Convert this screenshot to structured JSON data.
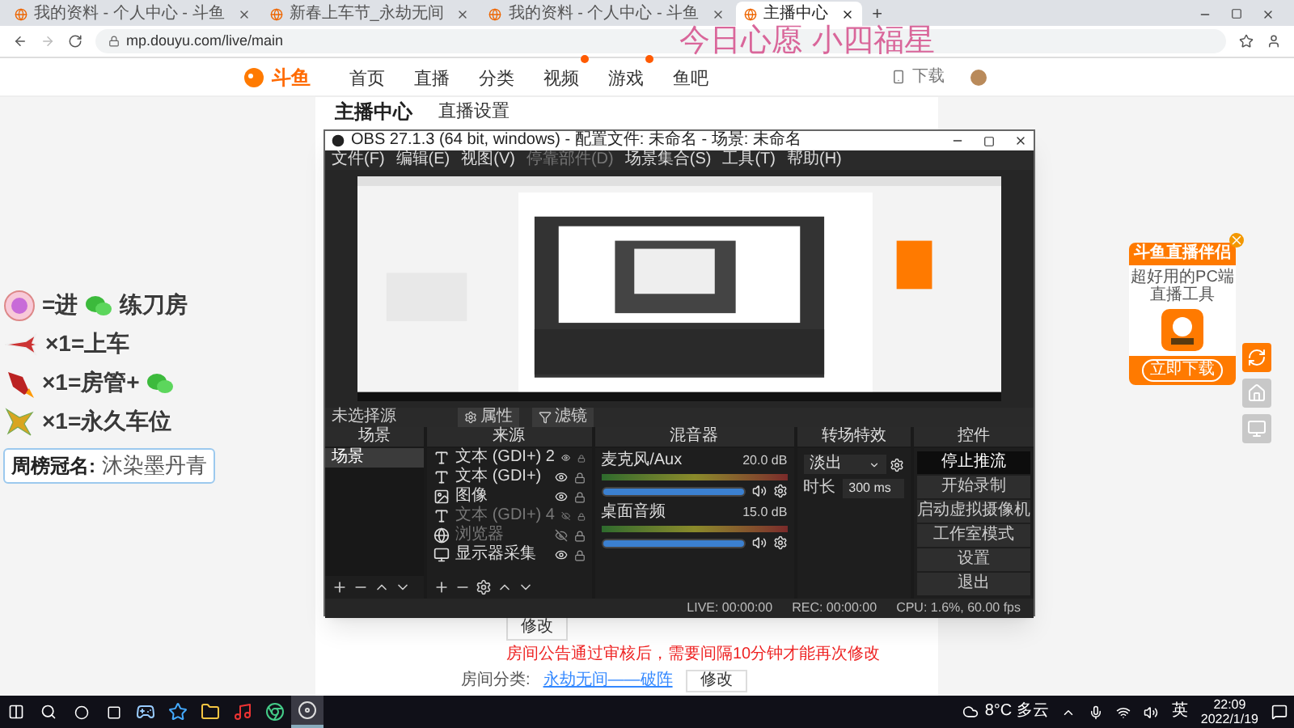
{
  "stream_overlay": {
    "wish_text": "今日心愿 小四福星"
  },
  "browser": {
    "tabs": [
      {
        "title": "我的资料 - 个人中心 - 斗鱼",
        "selected": false
      },
      {
        "title": "新春上车节_永劫无间",
        "selected": false
      },
      {
        "title": "我的资料 - 个人中心 - 斗鱼",
        "selected": false
      },
      {
        "title": "主播中心",
        "selected": true
      }
    ],
    "new_tab": "+",
    "url": "mp.douyu.com/live/main"
  },
  "site_header": {
    "logo": "斗鱼",
    "nav": [
      {
        "label": "首页",
        "badge": false
      },
      {
        "label": "直播",
        "badge": false
      },
      {
        "label": "分类",
        "badge": false
      },
      {
        "label": "视频",
        "badge": true
      },
      {
        "label": "游戏",
        "badge": true
      },
      {
        "label": "鱼吧",
        "badge": false
      }
    ],
    "download": "下载"
  },
  "page": {
    "sidebar_title": "主播中心",
    "section_title": "直播设置",
    "edit_button": "修改",
    "notice": "房间公告通过审核后，需要间隔10分钟才能再次修改",
    "category_label": "房间分类:",
    "category_value": "永劫无间——破阵",
    "category_button": "修改"
  },
  "gift_overlay": {
    "rows": [
      {
        "kind": "medal",
        "before": "=进",
        "wechat": true,
        "after": "练刀房"
      },
      {
        "kind": "plane",
        "before": "×1=上车",
        "wechat": false,
        "after": ""
      },
      {
        "kind": "rocket",
        "before": "×1=房管+",
        "wechat": true,
        "after": ""
      },
      {
        "kind": "spaceship",
        "before": "×1=永久车位",
        "wechat": false,
        "after": ""
      }
    ],
    "crown_label": "周榜冠名:",
    "crown_name": "沐染墨丹青"
  },
  "obs": {
    "title": "OBS 27.1.3 (64 bit, windows) - 配置文件: 未命名 - 场景: 未命名",
    "menu": [
      {
        "label": "文件(F)",
        "disabled": false
      },
      {
        "label": "编辑(E)",
        "disabled": false
      },
      {
        "label": "视图(V)",
        "disabled": false
      },
      {
        "label": "停靠部件(D)",
        "disabled": true
      },
      {
        "label": "场景集合(S)",
        "disabled": false
      },
      {
        "label": "工具(T)",
        "disabled": false
      },
      {
        "label": "帮助(H)",
        "disabled": false
      }
    ],
    "selection": "未选择源",
    "properties_button": "属性",
    "filters_button": "滤镜",
    "scenes": {
      "title": "场景",
      "items": [
        {
          "name": "场景",
          "selected": true
        }
      ]
    },
    "sources": {
      "title": "来源",
      "items": [
        {
          "kind": "text",
          "name": "文本 (GDI+) 2",
          "visible": true
        },
        {
          "kind": "text",
          "name": "文本 (GDI+)",
          "visible": true
        },
        {
          "kind": "image",
          "name": "图像",
          "visible": true
        },
        {
          "kind": "text",
          "name": "文本 (GDI+) 4",
          "visible": false
        },
        {
          "kind": "browser",
          "name": "浏览器",
          "visible": false
        },
        {
          "kind": "display",
          "name": "显示器采集",
          "visible": true
        }
      ]
    },
    "mixer": {
      "title": "混音器",
      "channels": [
        {
          "name": "麦克风/Aux",
          "reading": "20.0 dB",
          "level": 1
        },
        {
          "name": "桌面音频",
          "reading": "15.0 dB",
          "level": 1
        }
      ]
    },
    "transitions": {
      "title": "转场特效",
      "type": "淡出",
      "duration_label": "时长",
      "duration": "300 ms"
    },
    "controls": {
      "title": "控件",
      "buttons": [
        {
          "label": "停止推流",
          "active": true
        },
        {
          "label": "开始录制",
          "active": false
        },
        {
          "label": "启动虚拟摄像机",
          "active": false
        },
        {
          "label": "工作室模式",
          "active": false
        },
        {
          "label": "设置",
          "active": false
        },
        {
          "label": "退出",
          "active": false
        }
      ]
    },
    "status": {
      "live": "LIVE: 00:00:00",
      "rec": "REC: 00:00:00",
      "cpu": "CPU: 1.6%, 60.00 fps"
    }
  },
  "ad": {
    "title": "斗鱼直播伴侣",
    "subtitle": "超好用的PC端直播工具",
    "button": "立即下载"
  },
  "side_buttons": [
    {
      "kind": "replay",
      "selected": true
    },
    {
      "kind": "home",
      "selected": false
    },
    {
      "kind": "screen",
      "selected": false
    }
  ],
  "taskbar": {
    "apps": [
      {
        "kind": "steam",
        "selected": false
      },
      {
        "kind": "app",
        "selected": false
      },
      {
        "kind": "folder",
        "selected": false
      },
      {
        "kind": "netease",
        "selected": false
      },
      {
        "kind": "chrome",
        "selected": false
      },
      {
        "kind": "obs",
        "selected": true
      }
    ],
    "weather": "8°C 多云",
    "ime": "英",
    "time": "22:09",
    "date": "2022/1/19"
  }
}
